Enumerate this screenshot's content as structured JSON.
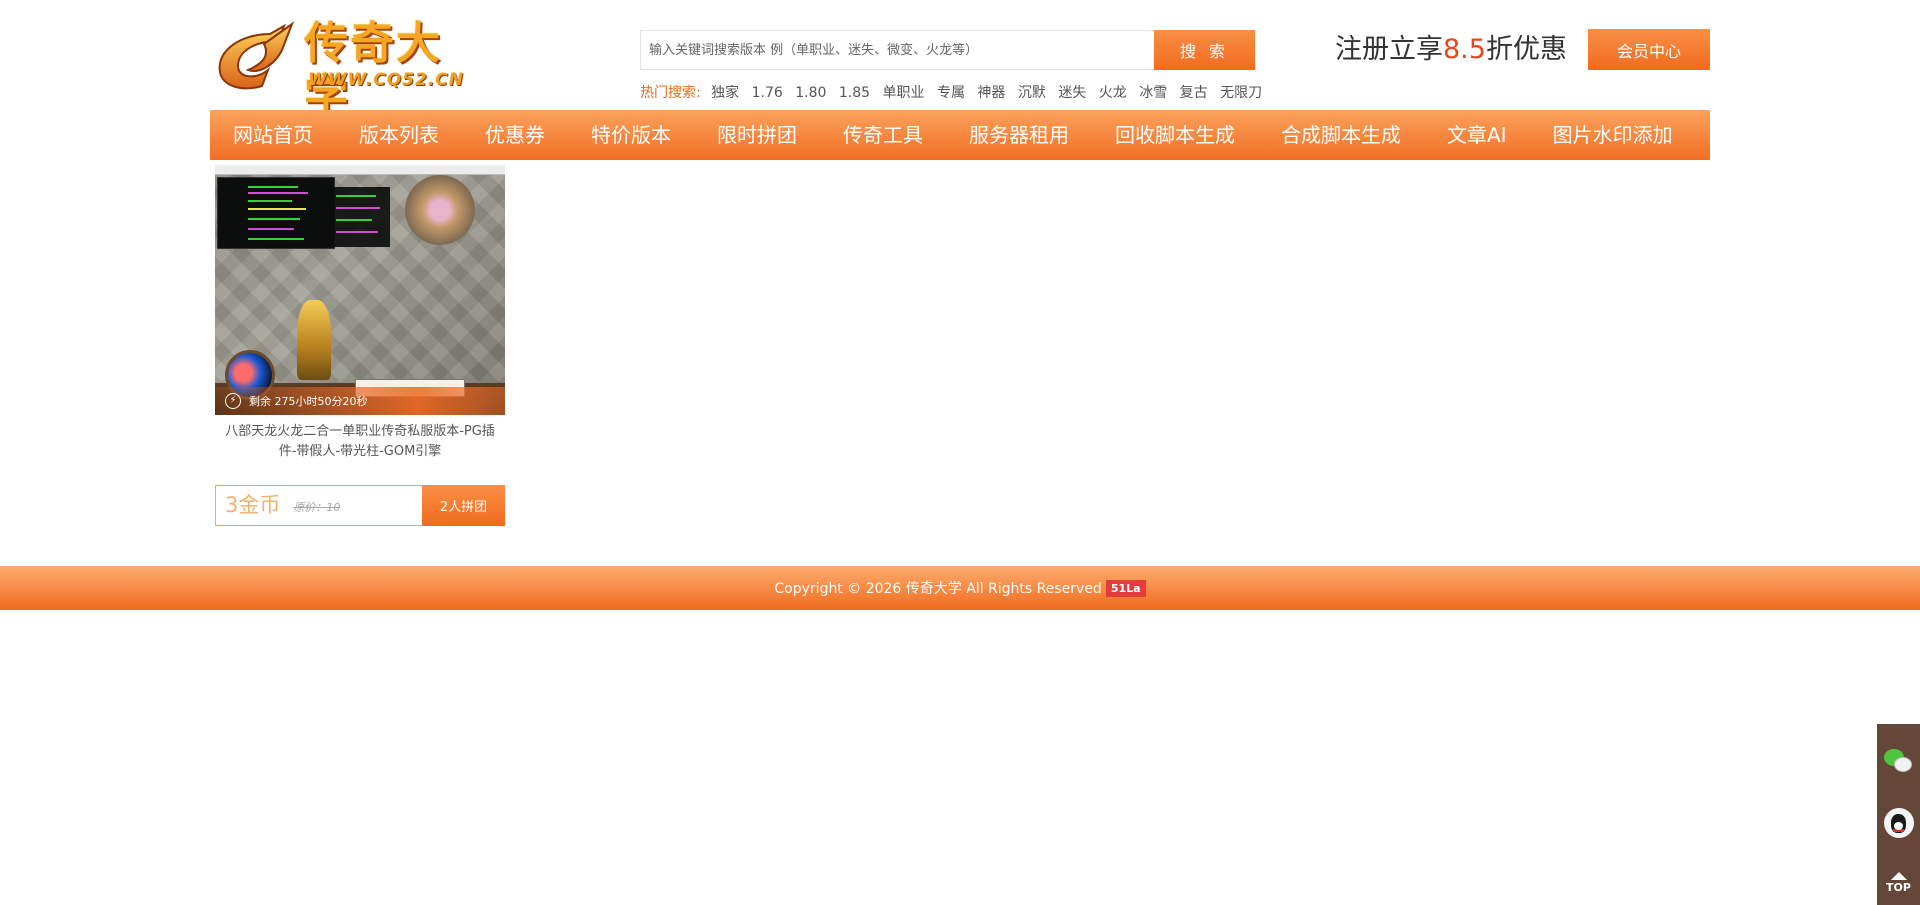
{
  "header": {
    "logo_text": "传奇大学",
    "logo_url": "WWW.CQ52.CN",
    "search_placeholder": "输入关键词搜索版本 例（单职业、迷失、微变、火龙等）",
    "search_button": "搜 索",
    "hot_label": "热门搜索:",
    "hot_items": [
      "独家",
      "1.76",
      "1.80",
      "1.85",
      "单职业",
      "专属",
      "神器",
      "沉默",
      "迷失",
      "火龙",
      "冰雪",
      "复古",
      "无限刀"
    ],
    "promo_prefix": "注册立享",
    "promo_number": "8.5",
    "promo_suffix": "折优惠",
    "member_button": "会员中心",
    "accent_color": "#f26b1d"
  },
  "nav": {
    "items": [
      "网站首页",
      "版本列表",
      "优惠券",
      "特价版本",
      "限时拼团",
      "传奇工具",
      "服务器租用",
      "回收脚本生成",
      "合成脚本生成",
      "文章AI",
      "图片水印添加"
    ]
  },
  "product": {
    "countdown": "剩余 275小时50分20秒",
    "title": "八部天龙火龙二合一单职业传奇私服版本-PG插件-带假人-带光柱-GOM引擎",
    "price": "3金币",
    "original_price": "原价：10",
    "group_button": "2人拼团"
  },
  "footer": {
    "copyright": "Copyright © 2026 传奇大学 All Rights Reserved",
    "badge": "51La"
  },
  "sidebar": {
    "top_label": "TOP"
  }
}
